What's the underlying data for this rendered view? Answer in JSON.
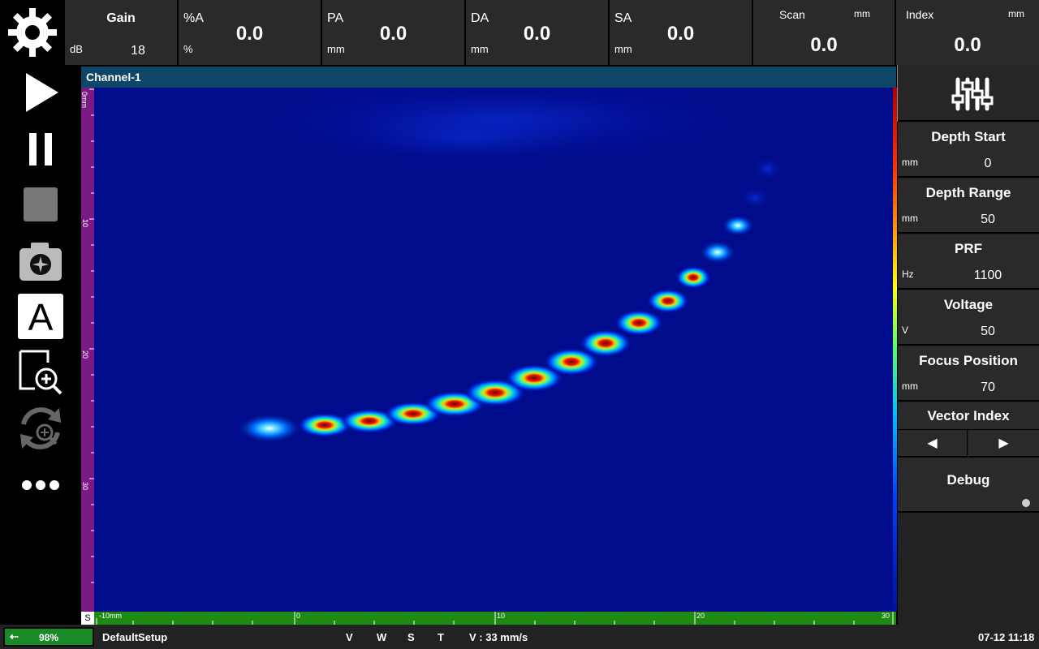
{
  "top_bar": {
    "gain": {
      "label": "Gain",
      "unit": "dB",
      "value": "18"
    },
    "cells": [
      {
        "label": "%A",
        "unit": "%",
        "value": "0.0"
      },
      {
        "label": "PA",
        "unit": "mm",
        "value": "0.0"
      },
      {
        "label": "DA",
        "unit": "mm",
        "value": "0.0"
      },
      {
        "label": "SA",
        "unit": "mm",
        "value": "0.0"
      }
    ],
    "scan": {
      "label": "Scan",
      "unit": "mm",
      "value": "0.0"
    },
    "index": {
      "label": "Index",
      "unit": "mm",
      "value": "0.0"
    }
  },
  "channel": {
    "title": "Channel-1"
  },
  "left_ruler": {
    "ticks": [
      "0mm",
      "10",
      "20",
      "30"
    ]
  },
  "bottom_ruler": {
    "corner": "S",
    "ticks": [
      "-10mm",
      "0",
      "10",
      "20",
      "30"
    ]
  },
  "right_panel": {
    "params": [
      {
        "title": "Depth Start",
        "unit": "mm",
        "value": "0"
      },
      {
        "title": "Depth Range",
        "unit": "mm",
        "value": "50"
      },
      {
        "title": "PRF",
        "unit": "Hz",
        "value": "1100"
      },
      {
        "title": "Voltage",
        "unit": "V",
        "value": "50"
      },
      {
        "title": "Focus Position",
        "unit": "mm",
        "value": "70"
      }
    ],
    "vector_index": {
      "title": "Vector Index",
      "prev": "◀",
      "next": "▶"
    },
    "debug": {
      "title": "Debug"
    }
  },
  "status_bar": {
    "battery": "98%",
    "setup": "DefaultSetup",
    "flags": [
      "V",
      "W",
      "S",
      "T"
    ],
    "velocity": "V : 33 mm/s",
    "datetime": "07-12 11:18"
  },
  "colors": {
    "accent_bar": "#0d4666",
    "scan_bg": "#010c8c",
    "left_ruler": "#7b1a85",
    "bottom_ruler": "#1d8a12"
  }
}
